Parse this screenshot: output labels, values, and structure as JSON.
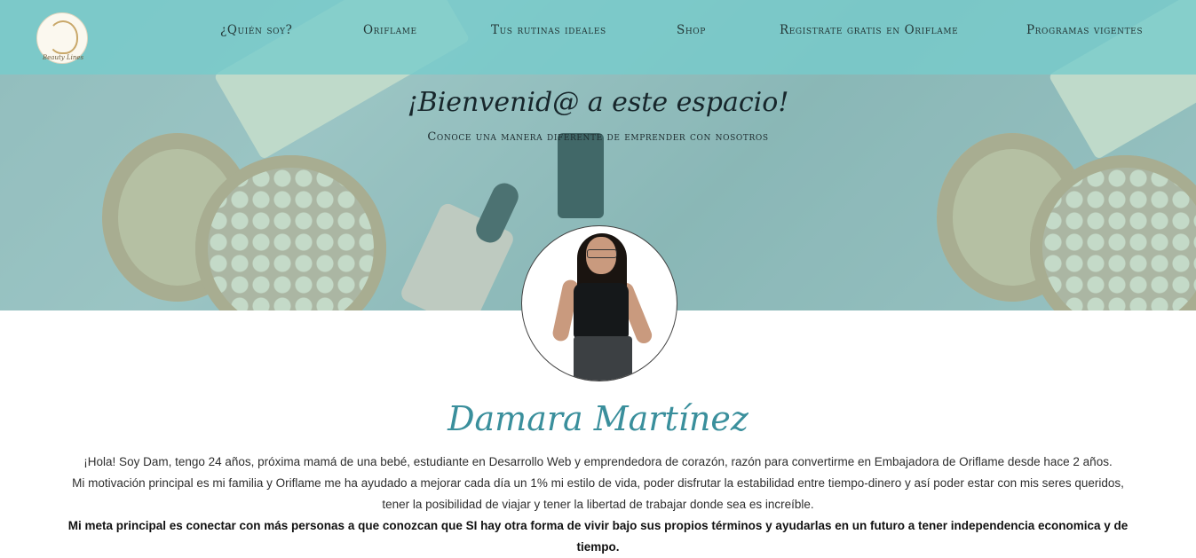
{
  "nav": {
    "logo_text": "Beauty Lines",
    "items": [
      {
        "label": "¿Quién soy?"
      },
      {
        "label": "Oriflame"
      },
      {
        "label": "Tus rutinas ideales"
      },
      {
        "label": "Shop"
      },
      {
        "label": "Registrate gratis en Oriflame"
      },
      {
        "label": "Programas vigentes"
      }
    ]
  },
  "hero": {
    "title": "¡Bienvenid@ a este espacio!",
    "subtitle": "Conoce una manera diferente de emprender con nosotros"
  },
  "profile": {
    "name": "Damara Martínez",
    "bio_line1": "¡Hola! Soy Dam, tengo 24 años, próxima mamá de una bebé, estudiante en Desarrollo Web y emprendedora de corazón, razón para convertirme en Embajadora de Oriflame desde hace 2 años.",
    "bio_line2": "Mi motivación principal es mi familia y Oriflame me ha ayudado a mejorar cada día un 1% mi estilo de vida, poder disfrutar la estabilidad entre tiempo-dinero y así poder estar con mis seres queridos, tener la posibilidad de viajar y tener la libertad de trabajar donde sea es increíble.",
    "bio_goal": "Mi meta principal es conectar con más personas a que conozcan que SI hay otra forma de vivir bajo sus propios términos y ayudarlas en un futuro a tener independencia economica y de tiempo."
  },
  "colors": {
    "nav_bg": "#76cccc",
    "name_color": "#3a8f9c",
    "text_color": "#2e2e2e"
  }
}
